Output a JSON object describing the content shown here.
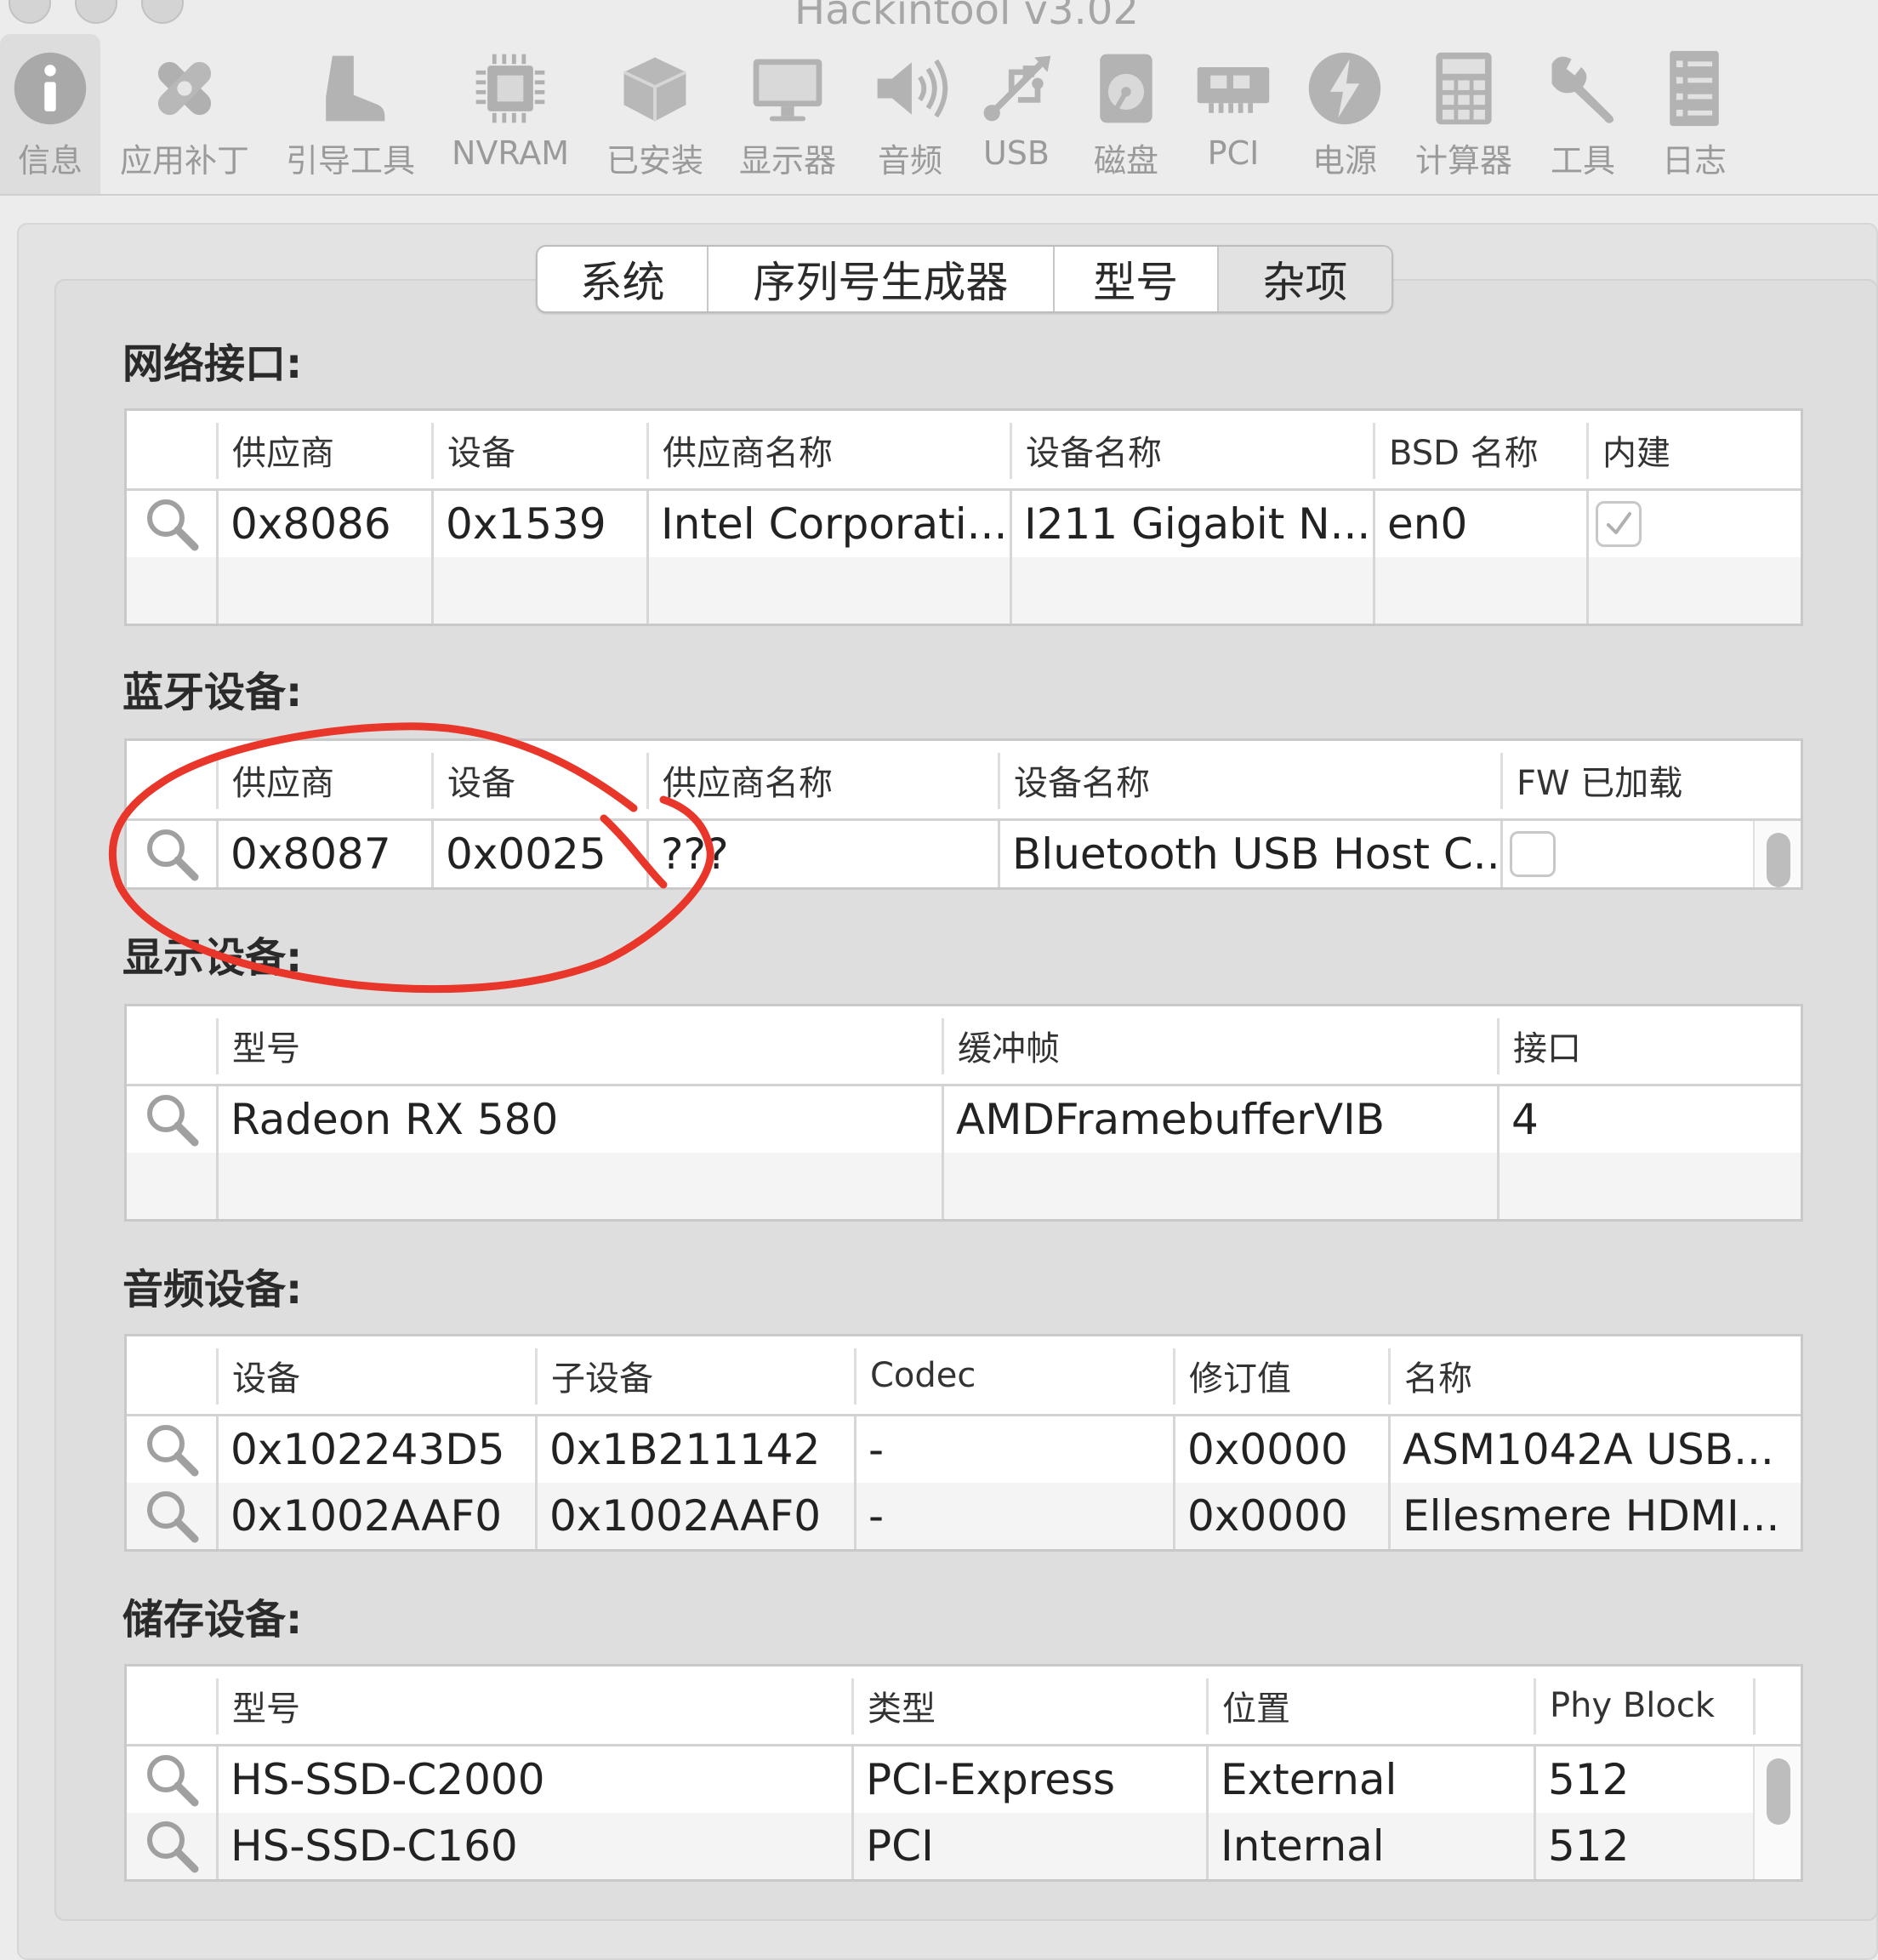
{
  "window": {
    "title": "Hackintool v3.02"
  },
  "toolbar": {
    "items": [
      {
        "label": "信息",
        "icon": "info-icon"
      },
      {
        "label": "应用补丁",
        "icon": "bandage-icon"
      },
      {
        "label": "引导工具",
        "icon": "boot-icon"
      },
      {
        "label": "NVRAM",
        "icon": "chip-icon"
      },
      {
        "label": "已安装",
        "icon": "package-icon"
      },
      {
        "label": "显示器",
        "icon": "monitor-icon"
      },
      {
        "label": "音频",
        "icon": "speaker-icon"
      },
      {
        "label": "USB",
        "icon": "usb-icon"
      },
      {
        "label": "磁盘",
        "icon": "disk-icon"
      },
      {
        "label": "PCI",
        "icon": "pci-card-icon"
      },
      {
        "label": "电源",
        "icon": "power-bolt-icon"
      },
      {
        "label": "计算器",
        "icon": "calculator-icon"
      },
      {
        "label": "工具",
        "icon": "wrench-icon"
      },
      {
        "label": "日志",
        "icon": "log-list-icon"
      }
    ],
    "selected": "信息"
  },
  "tabs": [
    {
      "label": "系统"
    },
    {
      "label": "序列号生成器"
    },
    {
      "label": "型号"
    },
    {
      "label": "杂项"
    }
  ],
  "network": {
    "title": "网络接口:",
    "columns": [
      "供应商",
      "设备",
      "供应商名称",
      "设备名称",
      "BSD 名称",
      "内建"
    ],
    "rows": [
      {
        "vendor": "0x8086",
        "device": "0x1539",
        "vendor_name": "Intel Corporati...",
        "device_name": "I211 Gigabit N...",
        "bsd": "en0",
        "builtin": true
      }
    ]
  },
  "bluetooth": {
    "title": "蓝牙设备:",
    "columns": [
      "供应商",
      "设备",
      "供应商名称",
      "设备名称",
      "FW 已加载"
    ],
    "rows": [
      {
        "vendor": "0x8087",
        "device": "0x0025",
        "vendor_name": "???",
        "device_name": "Bluetooth USB Host C...",
        "fw_loaded": false
      }
    ]
  },
  "display": {
    "title": "显示设备:",
    "columns": [
      "型号",
      "缓冲帧",
      "接口"
    ],
    "rows": [
      {
        "model": "Radeon RX 580",
        "framebuffer": "AMDFramebufferVIB",
        "ports": "4"
      }
    ]
  },
  "audio": {
    "title": "音频设备:",
    "columns": [
      "设备",
      "子设备",
      "Codec",
      "修订值",
      "名称"
    ],
    "rows": [
      {
        "device": "0x102243D5",
        "subdevice": "0x1B211142",
        "codec": "-",
        "revision": "0x0000",
        "name": "ASM1042A USB..."
      },
      {
        "device": "0x1002AAF0",
        "subdevice": "0x1002AAF0",
        "codec": "-",
        "revision": "0x0000",
        "name": "Ellesmere HDMI..."
      }
    ]
  },
  "storage": {
    "title": "储存设备:",
    "columns": [
      "型号",
      "类型",
      "位置",
      "Phy Block"
    ],
    "rows": [
      {
        "model": "HS-SSD-C2000",
        "type": "PCI-Express",
        "location": "External",
        "phy_block": "512"
      },
      {
        "model": "HS-SSD-C160",
        "type": "PCI",
        "location": "Internal",
        "phy_block": "512"
      }
    ]
  },
  "colors": {
    "annotation": "#e8362a",
    "selected_tool_bg": "#dddddd"
  }
}
